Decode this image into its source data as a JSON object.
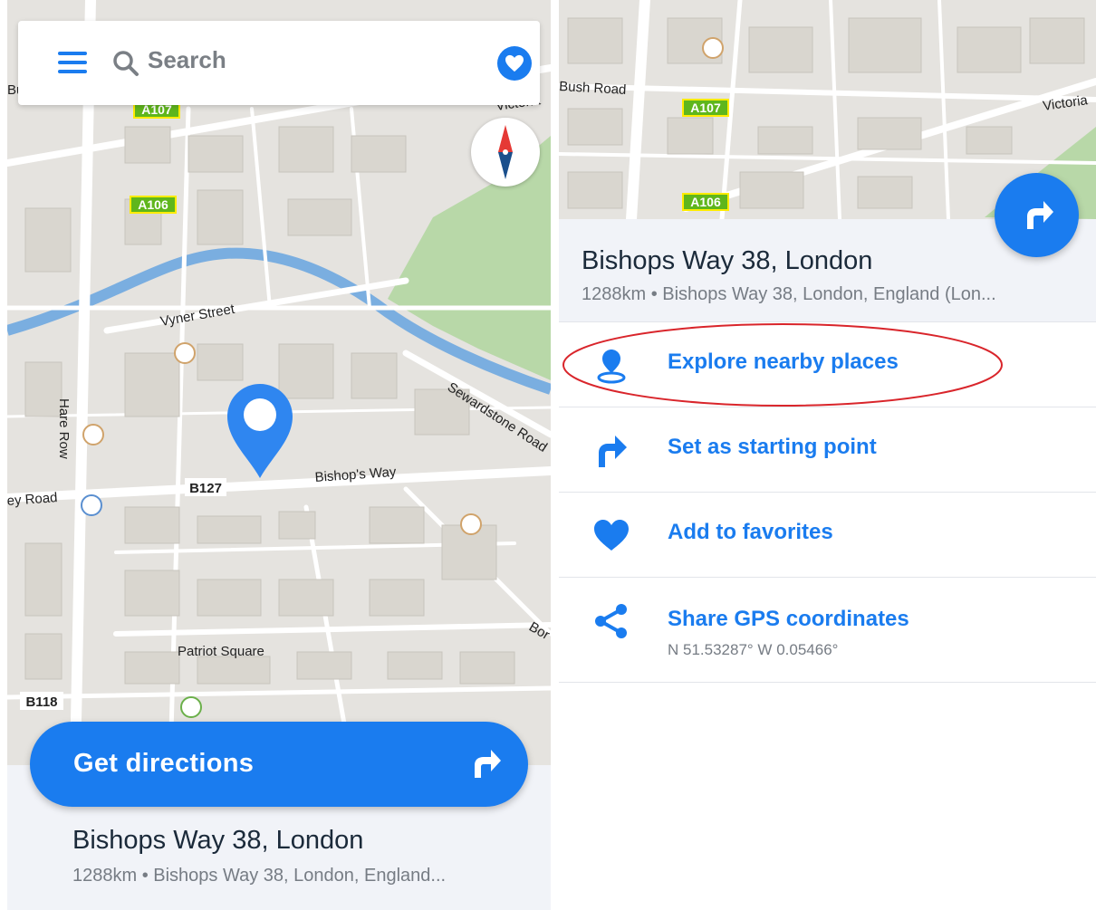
{
  "left": {
    "search": {
      "label": "Search"
    },
    "map": {
      "road_badges": [
        "A107",
        "A106",
        "B127",
        "B118"
      ],
      "street_labels": [
        "Vyner Street",
        "Hare Row",
        "Bishop's Way",
        "Sewardstone Road",
        "ey Road",
        "Patriot Square",
        "Victoria",
        "Bu",
        "Bor"
      ]
    },
    "get_directions_label": "Get directions",
    "place": {
      "title": "Bishops Way 38, London",
      "subtitle": "1288km • Bishops Way 38, London, England..."
    }
  },
  "right": {
    "map": {
      "road_badges": [
        "A107",
        "A106"
      ],
      "street_labels": [
        "Bush Road",
        "Victoria"
      ]
    },
    "place": {
      "title": "Bishops Way 38, London",
      "subtitle": "1288km • Bishops Way 38, London, England (Lon..."
    },
    "actions": [
      {
        "label": "Explore nearby places",
        "icon": "location-pin-icon"
      },
      {
        "label": "Set as starting point",
        "icon": "turn-right-arrow-icon"
      },
      {
        "label": "Add to favorites",
        "icon": "heart-icon"
      },
      {
        "label": "Share GPS coordinates",
        "icon": "share-icon",
        "sublabel": "N 51.53287° W 0.05466°"
      }
    ]
  },
  "colors": {
    "accent": "#1a7cef",
    "map_background": "#e5e3df",
    "park": "#b8d8a8",
    "water": "#7aaee0",
    "highlight_ellipse": "#d9252b"
  }
}
